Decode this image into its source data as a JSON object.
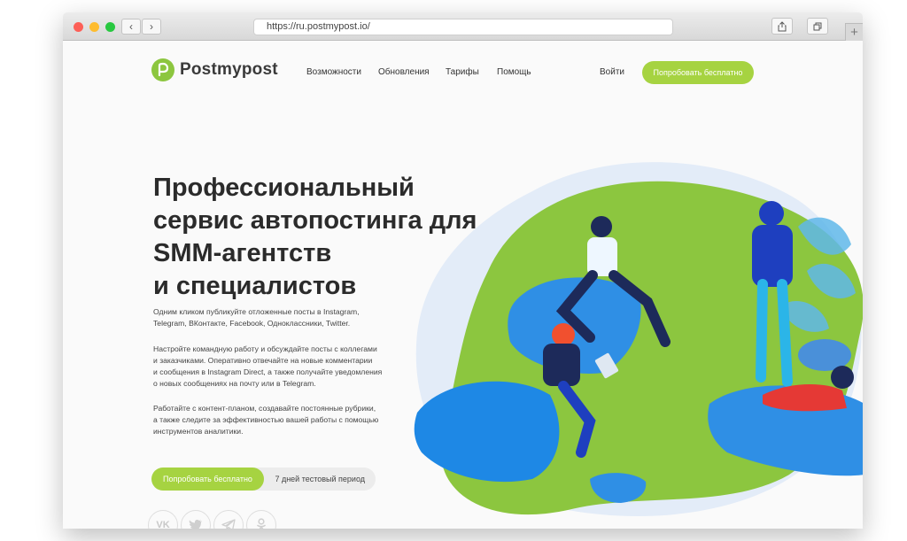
{
  "browser": {
    "url": "https://ru.postmypost.io/",
    "back_symbol": "‹",
    "forward_symbol": "›",
    "plus_symbol": "+",
    "icons": [
      "back-icon",
      "forward-icon",
      "share-icon",
      "tabs-icon"
    ]
  },
  "header": {
    "logo_text": "Postmypost",
    "nav": [
      "Возможности",
      "Обновления",
      "Тарифы",
      "Помощь"
    ],
    "login": "Войти",
    "cta": "Попробовать бесплатно"
  },
  "hero": {
    "title_lines": [
      "Профессиональный",
      "сервис автопостинга для",
      "SMM-агентств",
      "и специалистов"
    ],
    "paragraphs": [
      [
        "Одним кликом публикуйте отложенные посты в Instagram,",
        "Telegram, ВКонтакте, Facebook, Одноклассники, Twitter."
      ],
      [
        "Настройте командную работу и обсуждайте посты с коллегами",
        "и заказчиками. Оперативно отвечайте на новые комментарии",
        "и сообщения в Instagram Direct, а также получайте уведомления",
        "о новых сообщениях на почту или в Telegram."
      ],
      [
        "Работайте с контент-планом, создавайте постоянные рубрики,",
        "а также следите за эффективностью вашей работы с помощью",
        "инструментов аналитики."
      ]
    ],
    "cta": "Попробовать бесплатно",
    "trial": "7 дней тестовый период"
  },
  "social": {
    "icons": [
      "vk-icon",
      "twitter-icon",
      "telegram-icon",
      "odnoklassniki-icon"
    ],
    "vk_text": "VK"
  },
  "colors": {
    "accent": "#a6d341",
    "logo": "#8cc63f",
    "blob": "#8cc63f",
    "pillow": "#1e88e5",
    "text": "#2b2b2b"
  }
}
